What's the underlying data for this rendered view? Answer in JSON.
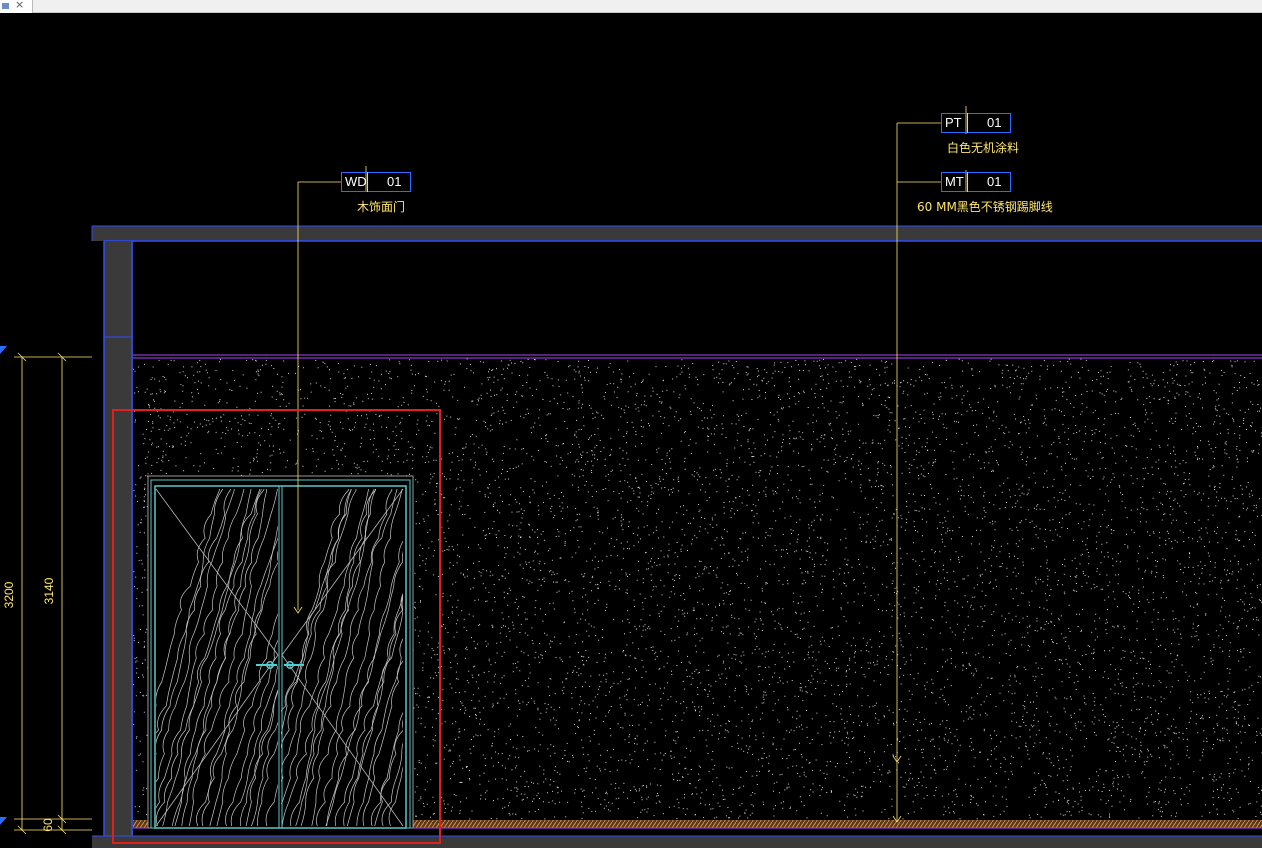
{
  "window": {
    "tab_close_glyph": "×"
  },
  "callouts": [
    {
      "code": "WD",
      "number": "01",
      "note": "木饰面门"
    },
    {
      "code": "PT",
      "number": "01",
      "note": "白色无机涂料"
    },
    {
      "code": "MT",
      "number": "01",
      "note": "60 MM黑色不锈钢踢脚线"
    }
  ],
  "dimensions": {
    "overall": "3200",
    "wall_height": "3140",
    "skirting": "60"
  },
  "colors": {
    "background": "#000000",
    "annotation_text": "#ffe66b",
    "tag_border": "#2e6bff",
    "ceiling_fill": "#3a3a3a",
    "wall_line": "#b040ff",
    "door_line": "#58c8c8",
    "speckle": "#d8d8d8",
    "selection": "#e0201e",
    "skirting": "#b87838"
  }
}
